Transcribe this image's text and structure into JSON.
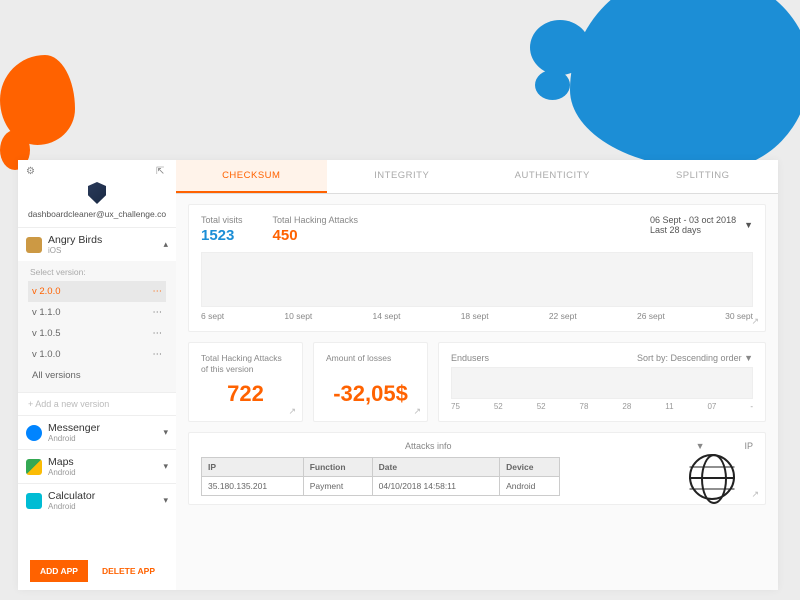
{
  "sidebar": {
    "email": "dashboardcleaner@ux_challenge.co",
    "apps": [
      {
        "name": "Angry Birds",
        "platform": "iOS",
        "active": true
      },
      {
        "name": "Messenger",
        "platform": "Android"
      },
      {
        "name": "Maps",
        "platform": "Android"
      },
      {
        "name": "Calculator",
        "platform": "Android"
      }
    ],
    "version_label": "Select version:",
    "versions": [
      "v 2.0.0",
      "v 1.1.0",
      "v 1.0.5",
      "v 1.0.0",
      "All versions"
    ],
    "selected_version": "v 2.0.0",
    "add_version": "+    Add a new version",
    "add_app": "ADD APP",
    "delete_app": "DELETE APP"
  },
  "tabs": [
    "CHECKSUM",
    "INTEGRITY",
    "AUTHENTICITY",
    "SPLITTING"
  ],
  "active_tab": "CHECKSUM",
  "stats": {
    "visits_label": "Total visits",
    "visits_value": "1523",
    "hacks_label": "Total Hacking Attacks",
    "hacks_value": "450",
    "date_line1": "06 Sept - 03 oct 2018",
    "date_line2": "Last 28 days"
  },
  "x_axis": [
    "6 sept",
    "10 sept",
    "14 sept",
    "18 sept",
    "22 sept",
    "26 sept",
    "30 sept"
  ],
  "mini_cards": {
    "hacks_version_label": "Total Hacking Attacks of this version",
    "hacks_version_value": "722",
    "losses_label": "Amount of losses",
    "losses_value": "-32,05$"
  },
  "endusers": {
    "title": "Endusers",
    "sort": "Sort by: Descending order",
    "x": [
      "75",
      "52",
      "52",
      "78",
      "28",
      "11",
      "07",
      "-"
    ]
  },
  "attacks": {
    "title": "Attacks info",
    "ip_label": "IP",
    "columns": [
      "IP",
      "Function",
      "Date",
      "Device"
    ],
    "rows": [
      {
        "ip": "35.180.135.201",
        "fn": "Payment",
        "date": "04/10/2018   14:58:11",
        "device": "Android"
      }
    ]
  }
}
